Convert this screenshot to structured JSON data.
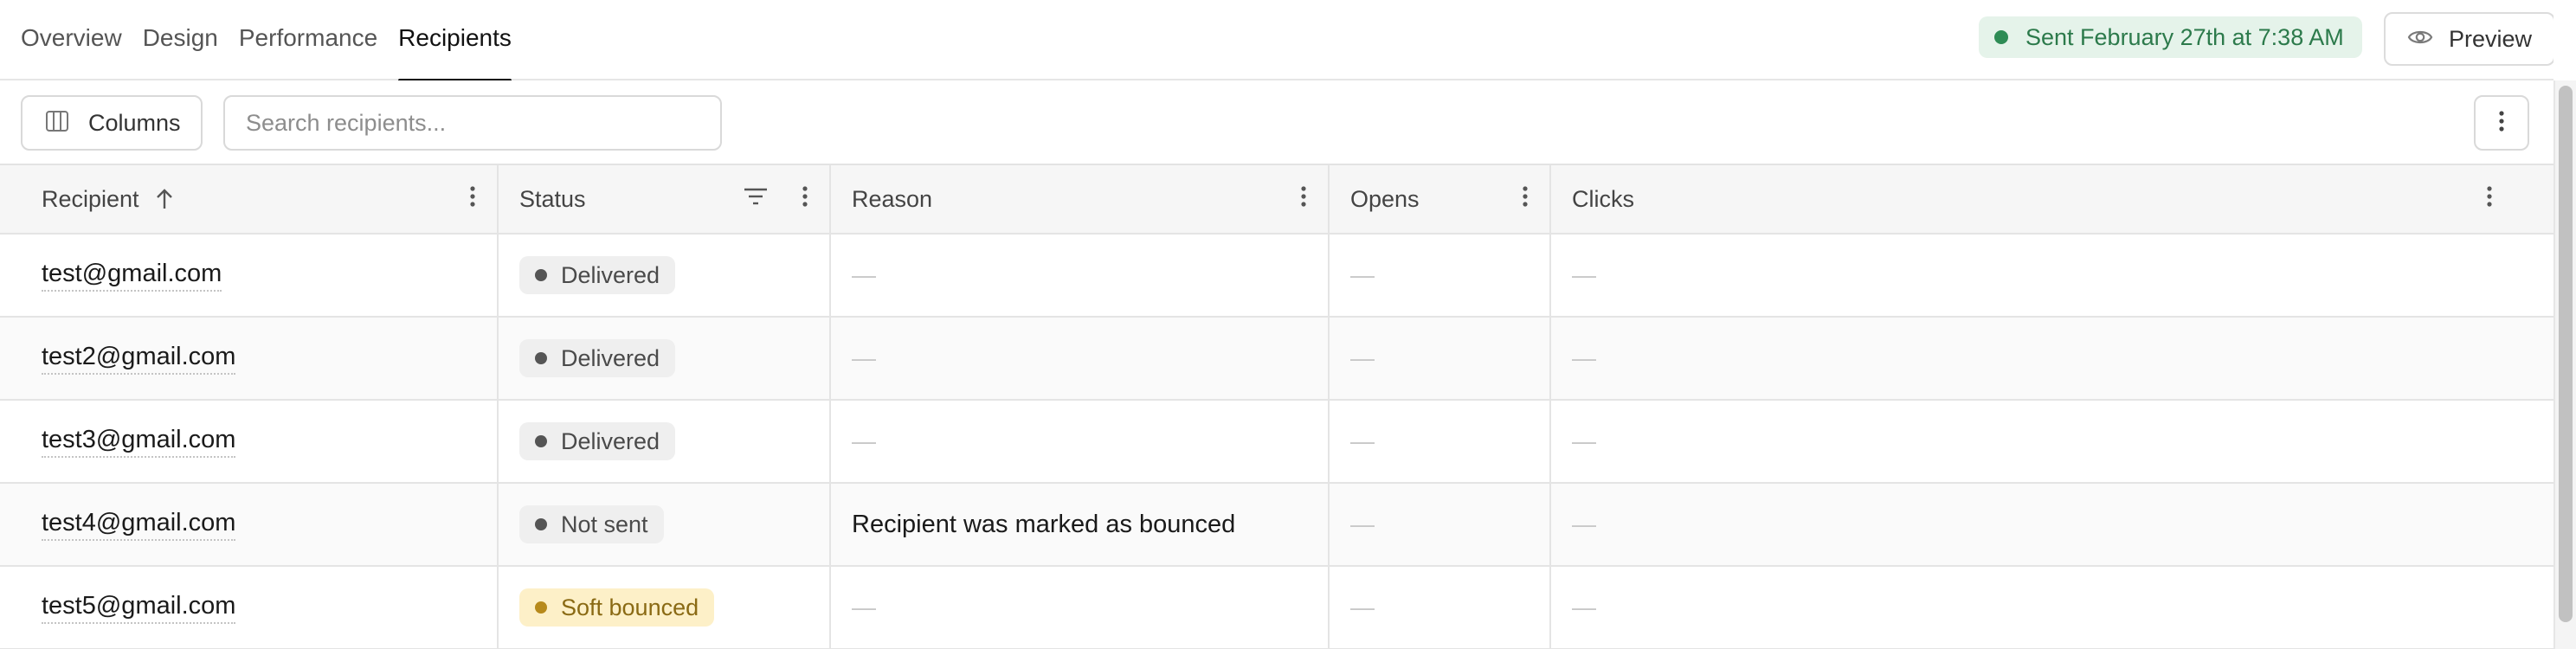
{
  "tabs": [
    {
      "label": "Overview",
      "active": false
    },
    {
      "label": "Design",
      "active": false
    },
    {
      "label": "Performance",
      "active": false
    },
    {
      "label": "Recipients",
      "active": true
    }
  ],
  "status": {
    "text": "Sent February 27th at 7:38 AM",
    "color": "#2e8c55"
  },
  "preview": {
    "label": "Preview",
    "icon": "eye-icon"
  },
  "toolbar": {
    "columns_label": "Columns",
    "columns_icon": "columns-icon",
    "search_placeholder": "Search recipients...",
    "search_value": ""
  },
  "table": {
    "headers": {
      "recipient": "Recipient",
      "status": "Status",
      "reason": "Reason",
      "opens": "Opens",
      "clicks": "Clicks"
    },
    "sort": {
      "column": "recipient",
      "direction": "ascending"
    },
    "rows": [
      {
        "recipient": "test@gmail.com",
        "status": "Delivered",
        "status_kind": "neutral",
        "reason": "—",
        "opens": "—",
        "clicks": "—"
      },
      {
        "recipient": "test2@gmail.com",
        "status": "Delivered",
        "status_kind": "neutral",
        "reason": "—",
        "opens": "—",
        "clicks": "—"
      },
      {
        "recipient": "test3@gmail.com",
        "status": "Delivered",
        "status_kind": "neutral",
        "reason": "—",
        "opens": "—",
        "clicks": "—"
      },
      {
        "recipient": "test4@gmail.com",
        "status": "Not sent",
        "status_kind": "neutral",
        "reason": "Recipient was marked as bounced",
        "opens": "—",
        "clicks": "—"
      },
      {
        "recipient": "test5@gmail.com",
        "status": "Soft bounced",
        "status_kind": "warning",
        "reason": "—",
        "opens": "—",
        "clicks": "—"
      }
    ]
  },
  "colors": {
    "accent_text": "#111111",
    "status_bg": "#e5f3ea",
    "warning_bg": "#fdf0c8",
    "warning_dot": "#b78a1c"
  }
}
